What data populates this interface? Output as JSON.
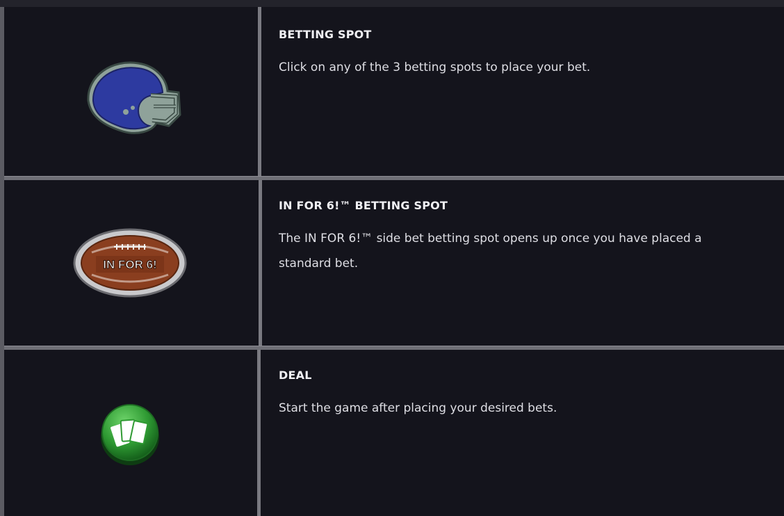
{
  "rows": [
    {
      "icon": "football-helmet-icon",
      "title": "BETTING SPOT",
      "description": "Click on any of the 3 betting spots to place your bet."
    },
    {
      "icon": "in-for-6-football-icon",
      "title": "IN FOR 6!™ BETTING SPOT",
      "description": "The IN FOR 6!™ side bet betting spot opens up once you have placed a standard bet.",
      "icon_label": "IN FOR 6!"
    },
    {
      "icon": "deal-cards-button-icon",
      "title": "DEAL",
      "description": "Start the game after placing your desired bets."
    }
  ],
  "colors": {
    "background": "#14141c",
    "divider": "#7a7a81",
    "helmet": "#2d3aa0",
    "football": "#8a3e1f",
    "deal_button": "#2f9a33"
  }
}
